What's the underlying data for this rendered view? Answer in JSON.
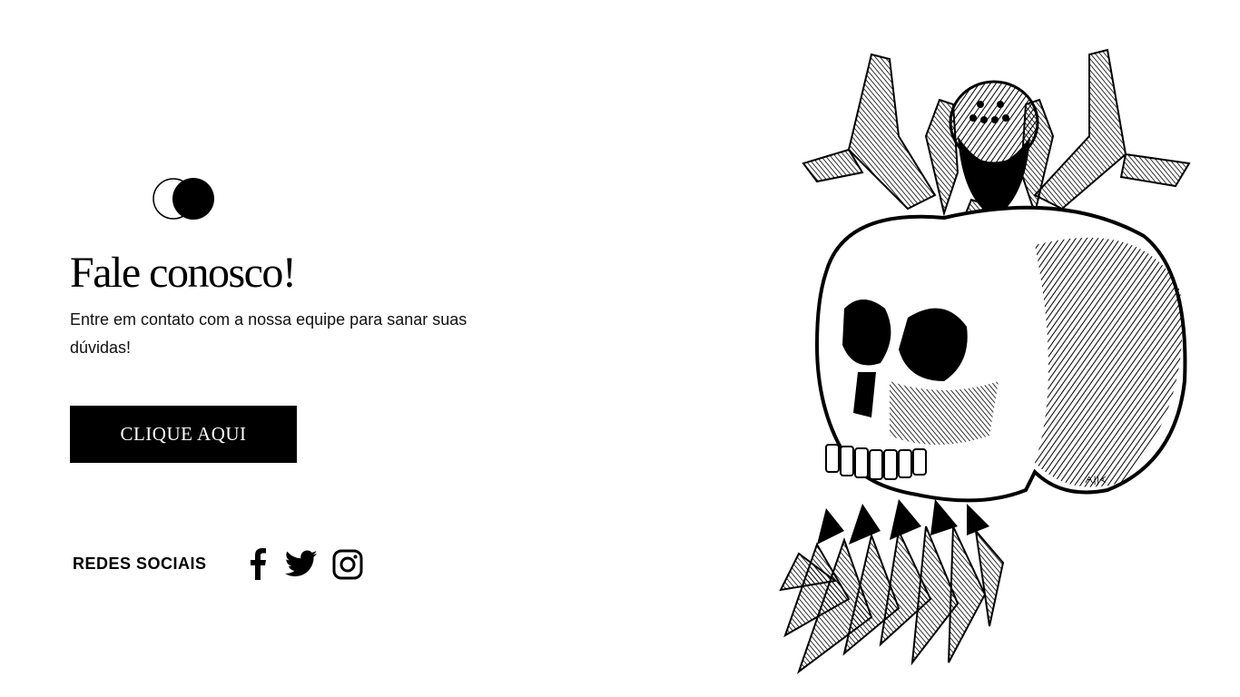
{
  "brand": {
    "logo_icon": "overlapping-circles-logo-icon"
  },
  "contact": {
    "title": "Fale conosco!",
    "subtitle": "Entre em contato com a nossa equipe para sanar suas dúvidas!",
    "cta_label": "CLIQUE AQUI"
  },
  "social": {
    "label": "REDES SOCIAIS",
    "links": [
      {
        "icon": "facebook-icon"
      },
      {
        "icon": "twitter-icon"
      },
      {
        "icon": "instagram-icon"
      }
    ]
  },
  "illustration": {
    "icon": "skull-with-spider-illustration",
    "signature": "ᗅ||ᗉ"
  },
  "colors": {
    "background": "#ffffff",
    "ink": "#000000",
    "button_text": "#ffffff"
  }
}
